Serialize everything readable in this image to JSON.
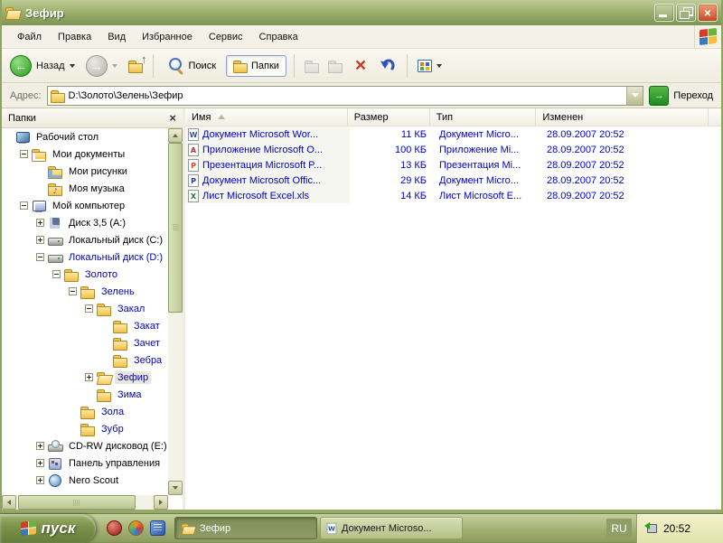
{
  "theme": {
    "link_blue": "#0000CC",
    "title_olive": "#7E9254",
    "taskbar_green": "#A2B172",
    "tray_yellow": "#EDEDC8",
    "selection_inactive": "#E9E6DB"
  },
  "window": {
    "title": "Зефир"
  },
  "menu": {
    "items": [
      "Файл",
      "Правка",
      "Вид",
      "Избранное",
      "Сервис",
      "Справка"
    ]
  },
  "toolbar": {
    "back_label": "Назад",
    "search_label": "Поиск",
    "folders_label": "Папки"
  },
  "address": {
    "label": "Адрес:",
    "path": "D:\\Золото\\Зелень\\Зефир",
    "go_label": "Переход"
  },
  "folders_panel": {
    "title": "Папки",
    "tree": [
      {
        "label": "Рабочий стол",
        "level": 0,
        "exp": null,
        "icon": "desktop",
        "link": false,
        "selected": false
      },
      {
        "label": "Мои документы",
        "level": 1,
        "exp": "minus",
        "icon": "folder-docs",
        "link": false,
        "selected": false
      },
      {
        "label": "Мои рисунки",
        "level": 2,
        "exp": null,
        "icon": "folder-pictures",
        "link": false,
        "selected": false
      },
      {
        "label": "Моя музыка",
        "level": 2,
        "exp": null,
        "icon": "folder-music",
        "link": false,
        "selected": false
      },
      {
        "label": "Мой компьютер",
        "level": 1,
        "exp": "minus",
        "icon": "computer",
        "link": false,
        "selected": false
      },
      {
        "label": "Диск 3,5 (A:)",
        "level": 2,
        "exp": "plus",
        "icon": "floppy",
        "link": false,
        "selected": false
      },
      {
        "label": "Локальный диск (C:)",
        "level": 2,
        "exp": "plus",
        "icon": "disk",
        "link": false,
        "selected": false
      },
      {
        "label": "Локальный диск (D:)",
        "level": 2,
        "exp": "minus",
        "icon": "disk",
        "link": true,
        "selected": false
      },
      {
        "label": "Золото",
        "level": 3,
        "exp": "minus",
        "icon": "folder",
        "link": true,
        "selected": false
      },
      {
        "label": "Зелень",
        "level": 4,
        "exp": "minus",
        "icon": "folder",
        "link": true,
        "selected": false
      },
      {
        "label": "Закал",
        "level": 5,
        "exp": "minus",
        "icon": "folder",
        "link": true,
        "selected": false
      },
      {
        "label": "Закат",
        "level": 6,
        "exp": null,
        "icon": "folder",
        "link": true,
        "selected": false
      },
      {
        "label": "Зачет",
        "level": 6,
        "exp": null,
        "icon": "folder",
        "link": true,
        "selected": false
      },
      {
        "label": "Зебра",
        "level": 6,
        "exp": null,
        "icon": "folder",
        "link": true,
        "selected": false
      },
      {
        "label": "Зефир",
        "level": 5,
        "exp": "plus",
        "icon": "folder-open",
        "link": true,
        "selected": true
      },
      {
        "label": "Зима",
        "level": 5,
        "exp": null,
        "icon": "folder",
        "link": true,
        "selected": false
      },
      {
        "label": "Зола",
        "level": 4,
        "exp": null,
        "icon": "folder",
        "link": true,
        "selected": false
      },
      {
        "label": "Зубр",
        "level": 4,
        "exp": null,
        "icon": "folder",
        "link": true,
        "selected": false
      },
      {
        "label": "CD-RW дисковод (E:)",
        "level": 2,
        "exp": "plus",
        "icon": "cd",
        "link": false,
        "selected": false
      },
      {
        "label": "Панель управления",
        "level": 2,
        "exp": "plus",
        "icon": "control-panel",
        "link": false,
        "selected": false
      },
      {
        "label": "Nero Scout",
        "level": 2,
        "exp": "plus",
        "icon": "nero",
        "link": false,
        "selected": false
      }
    ]
  },
  "file_list": {
    "columns": [
      {
        "label": "Имя",
        "sorted": true
      },
      {
        "label": "Размер"
      },
      {
        "label": "Тип"
      },
      {
        "label": "Изменен"
      }
    ],
    "rows": [
      {
        "icon": "word",
        "name": "Документ Microsoft Wor...",
        "size": "11 КБ",
        "type": "Документ Micro...",
        "modified": "28.09.2007 20:52"
      },
      {
        "icon": "access",
        "name": "Приложение Microsoft O...",
        "size": "100 КБ",
        "type": "Приложение Mi...",
        "modified": "28.09.2007 20:52"
      },
      {
        "icon": "powerpoint",
        "name": "Презентация Microsoft P...",
        "size": "13 КБ",
        "type": "Презентация Mi...",
        "modified": "28.09.2007 20:52"
      },
      {
        "icon": "publisher",
        "name": "Документ Microsoft Offic...",
        "size": "29 КБ",
        "type": "Документ Micro...",
        "modified": "28.09.2007 20:52"
      },
      {
        "icon": "excel",
        "name": "Лист Microsoft Excel.xls",
        "size": "14 КБ",
        "type": "Лист Microsoft E...",
        "modified": "28.09.2007 20:52"
      }
    ]
  },
  "taskbar": {
    "start_label": "пуск",
    "quick_launch": [
      "nero",
      "media-player",
      "show-desktop"
    ],
    "buttons": [
      {
        "label": "Зефир",
        "icon": "folder-open",
        "active": true
      },
      {
        "label": "Документ Microso...",
        "icon": "word",
        "active": false
      }
    ],
    "language": "RU",
    "tray": {
      "clock": "20:52",
      "icons": [
        "safely-remove-hardware"
      ]
    }
  }
}
